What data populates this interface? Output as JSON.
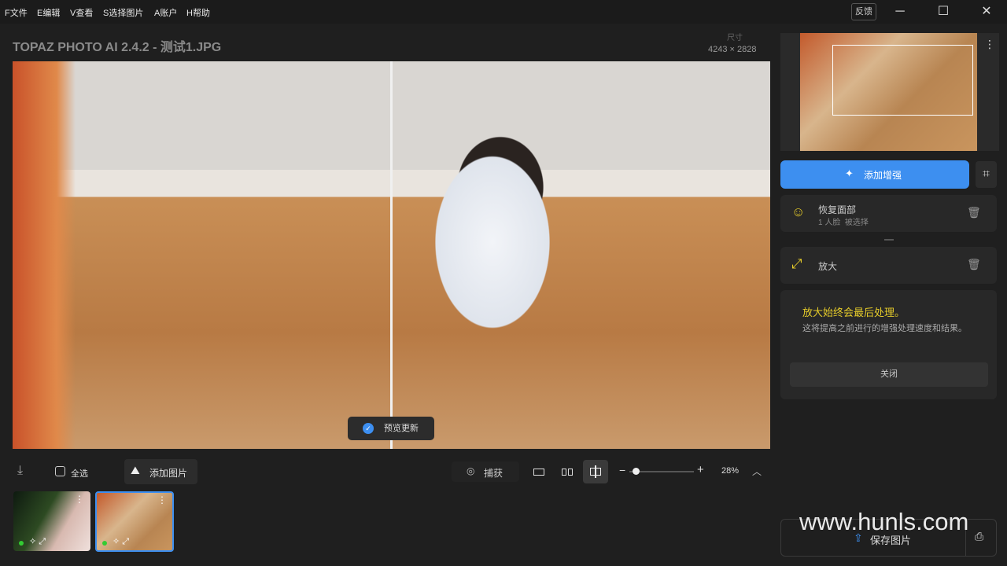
{
  "menu": [
    "F文件",
    "E编辑",
    "V查看",
    "S选择图片",
    "A账户",
    "H帮助"
  ],
  "feedback": "反馈",
  "window_controls": {
    "minimize": "─",
    "maximize": "☐",
    "close": "✕"
  },
  "title": "TOPAZ PHOTO AI 2.4.2 - 测试1.JPG",
  "dimensions": {
    "label": "尺寸",
    "value": "4243 × 2828"
  },
  "preview_status": "预览更新",
  "toolbar": {
    "select_all": "全选",
    "add_image": "添加图片",
    "capture": "捕获",
    "zoom": "28%"
  },
  "zoom_level": 0.1,
  "sidebar": {
    "add_enhance": "添加增强",
    "face": {
      "title": "恢复面部",
      "subtitle": "1 人脸  被选择"
    },
    "upscale": {
      "title": "放大"
    },
    "notice": {
      "title": "放大始终会最后处理。",
      "body": "这将提高之前进行的增强处理速度和结果。",
      "close": "关闭"
    },
    "save": "保存图片"
  },
  "watermark": "www.hunls.com",
  "colors": {
    "accent": "#3d8ff0",
    "yellow": "#e6cc2a"
  }
}
